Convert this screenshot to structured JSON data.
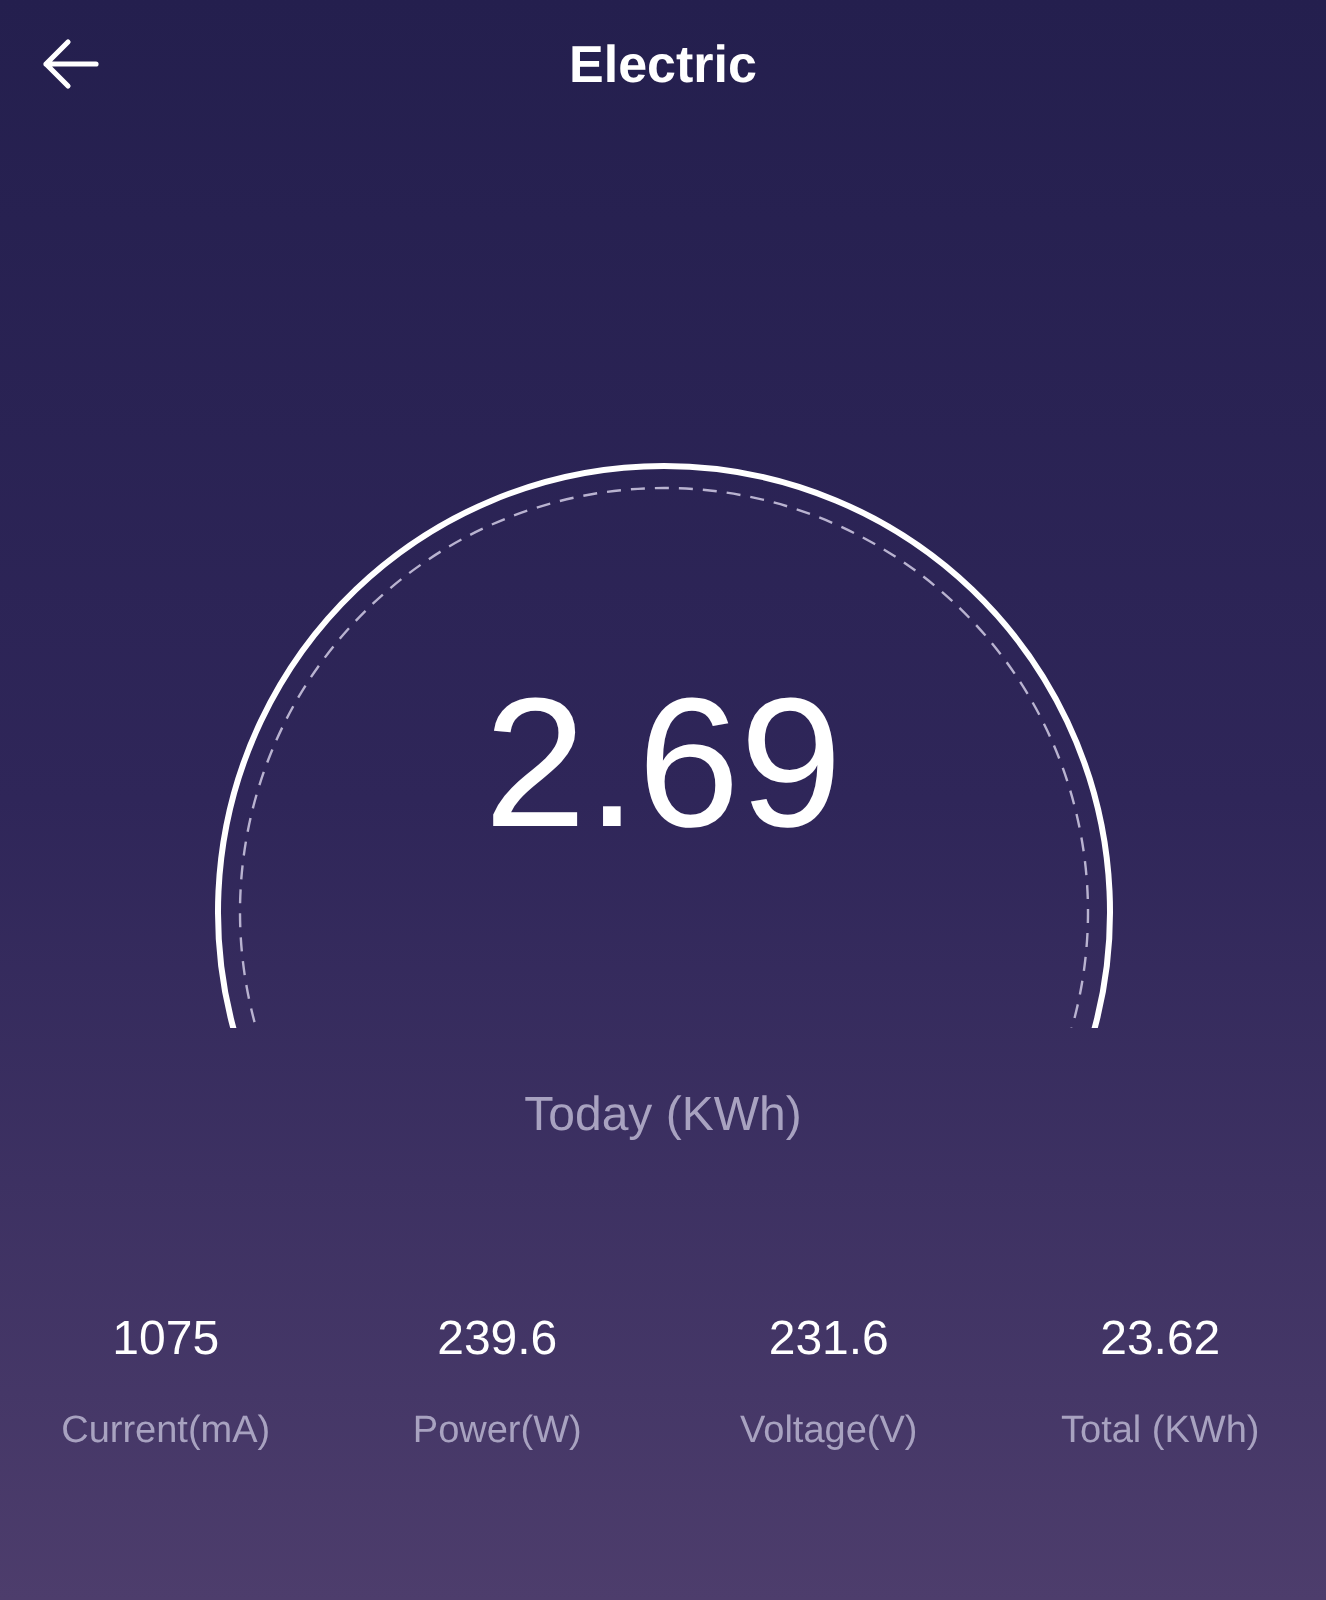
{
  "header": {
    "title": "Electric"
  },
  "gauge": {
    "value": "2.69",
    "caption": "Today (KWh)"
  },
  "stats": [
    {
      "value": "1075",
      "label": "Current(mA)"
    },
    {
      "value": "239.6",
      "label": "Power(W)"
    },
    {
      "value": "231.6",
      "label": "Voltage(V)"
    },
    {
      "value": "23.62",
      "label": "Total (KWh)"
    }
  ]
}
